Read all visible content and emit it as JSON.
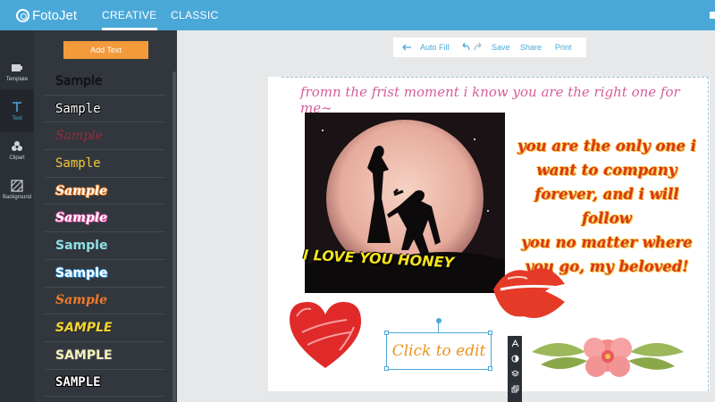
{
  "app": {
    "logo_text": "FotoJet",
    "tabs": [
      {
        "label": "CREATIVE",
        "active": true
      },
      {
        "label": "CLASSIC",
        "active": false
      }
    ]
  },
  "rail": {
    "items": [
      {
        "label": "Template",
        "icon": "template-icon"
      },
      {
        "label": "Text",
        "icon": "text-icon",
        "active": true
      },
      {
        "label": "Clipart",
        "icon": "clipart-icon"
      },
      {
        "label": "Background",
        "icon": "background-icon"
      }
    ]
  },
  "panel": {
    "add_text_label": "Add Text",
    "samples": [
      "Sample",
      "Sample",
      "Sample",
      "Sample",
      "Sample",
      "Sample",
      "Sample",
      "Sample",
      "Sample",
      "SAMPLE",
      "SAMPLE",
      "SAMPLE"
    ]
  },
  "toolbar": {
    "autofill_label": "Auto Fill",
    "save_label": "Save",
    "share_label": "Share",
    "print_label": "Print"
  },
  "canvas": {
    "headline": "fromn the frist moment i know you are the right one for me~",
    "photo_caption": "I LOVE YOU HONEY",
    "verse_lines": [
      "you are the only one i",
      "want to company",
      "forever, and i will follow",
      "you no matter where",
      "you go, my beloved!"
    ],
    "click_edit": "Click to edit"
  },
  "colors": {
    "topbar": "#4aa8d8",
    "accent_orange": "#f39a3b",
    "panel_bg": "#32373e",
    "rail_bg": "#2b3037"
  }
}
